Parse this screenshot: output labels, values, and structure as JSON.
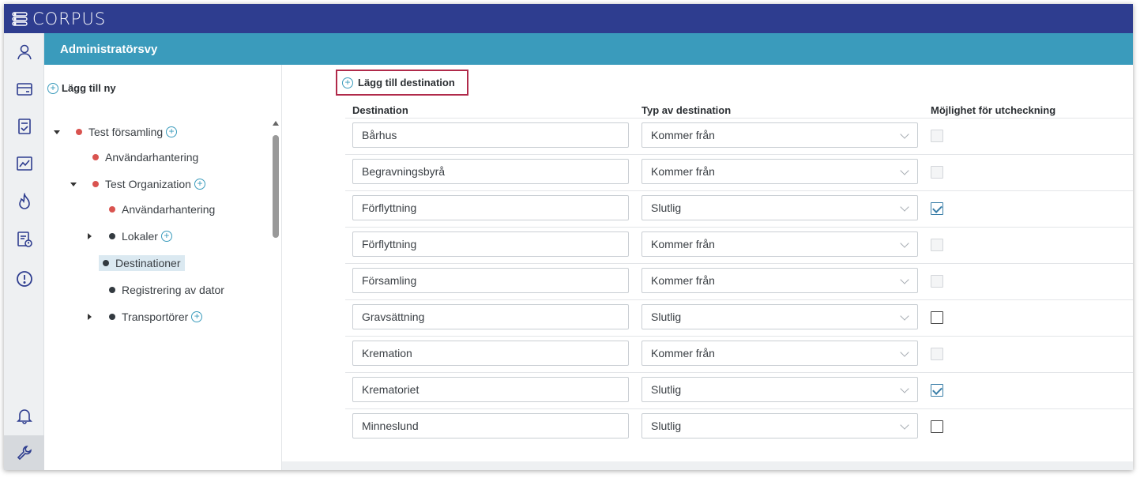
{
  "app": {
    "logo_text": "CORPUS"
  },
  "header": {
    "title": "Administratörsvy"
  },
  "rail": {
    "items": [
      {
        "icon": "user-icon"
      },
      {
        "icon": "card-icon"
      },
      {
        "icon": "checklist-icon"
      },
      {
        "icon": "chart-icon"
      },
      {
        "icon": "flame-icon"
      },
      {
        "icon": "document-alert-icon"
      },
      {
        "icon": "alert-circle-icon"
      },
      {
        "icon": "bell-icon"
      },
      {
        "icon": "wrench-icon"
      }
    ]
  },
  "tree": {
    "add_new_label": "Lägg till ny",
    "nodes": [
      {
        "label": "Test församling",
        "dot": "red",
        "caret": "down",
        "has_add": true
      },
      {
        "label": "Användarhantering",
        "dot": "red"
      },
      {
        "label": "Test Organization",
        "dot": "red",
        "caret": "down",
        "has_add": true
      },
      {
        "label": "Användarhantering",
        "dot": "red"
      },
      {
        "label": "Lokaler",
        "dot": "dark",
        "caret": "right",
        "has_add": true
      },
      {
        "label": "Destinationer",
        "dot": "dark",
        "selected": true
      },
      {
        "label": "Registrering av dator",
        "dot": "dark"
      },
      {
        "label": "Transportörer",
        "dot": "dark",
        "caret": "right",
        "has_add": true
      }
    ]
  },
  "main": {
    "add_button_label": "Lägg till destination",
    "columns": [
      "Destination",
      "Typ av destination",
      "Möjlighet för utcheckning"
    ],
    "rows": [
      {
        "destination": "Bårhus",
        "type": "Kommer från",
        "checkout": "disabled"
      },
      {
        "destination": "Begravningsbyrå",
        "type": "Kommer från",
        "checkout": "disabled"
      },
      {
        "destination": "Förflyttning",
        "type": "Slutlig",
        "checkout": "checked"
      },
      {
        "destination": "Förflyttning",
        "type": "Kommer från",
        "checkout": "disabled"
      },
      {
        "destination": "Församling",
        "type": "Kommer från",
        "checkout": "disabled"
      },
      {
        "destination": "Gravsättning",
        "type": "Slutlig",
        "checkout": "unchecked"
      },
      {
        "destination": "Kremation",
        "type": "Kommer från",
        "checkout": "disabled"
      },
      {
        "destination": "Krematoriet",
        "type": "Slutlig",
        "checkout": "checked"
      },
      {
        "destination": "Minneslund",
        "type": "Slutlig",
        "checkout": "unchecked"
      }
    ]
  },
  "colors": {
    "topbar": "#2e3d8f",
    "header": "#3a9bbc",
    "accent": "#3a9bbc",
    "highlight_border": "#b02a4a",
    "status_red": "#d9534f"
  }
}
